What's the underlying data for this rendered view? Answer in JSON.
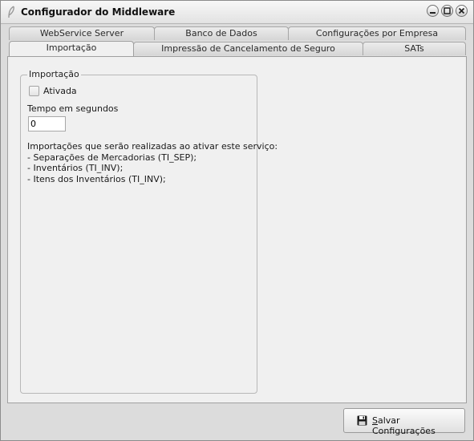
{
  "window": {
    "title": "Configurador do Middleware"
  },
  "tabs_row1": [
    {
      "label": "WebService Server"
    },
    {
      "label": "Banco de Dados"
    },
    {
      "label": "Configurações por Empresa"
    }
  ],
  "tabs_row2": [
    {
      "label": "Importação",
      "active": true
    },
    {
      "label": "Impressão de Cancelamento de Seguro"
    },
    {
      "label": "SATs"
    }
  ],
  "importacao": {
    "group_title": "Importação",
    "ativada_label": "Ativada",
    "ativada_checked": false,
    "tempo_label": "Tempo em segundos",
    "tempo_value": "0",
    "info_lines": [
      "Importações que serão realizadas ao ativar este serviço:",
      "- Separações de Mercadorias (TI_SEP);",
      "- Inventários (TI_INV);",
      "- Itens dos Inventários (TI_INV);"
    ]
  },
  "footer": {
    "save_label_first": "S",
    "save_label_rest": "alvar Configurações"
  },
  "icons": {
    "app": "feather-icon",
    "minimize": "minimize-icon",
    "maximize": "maximize-icon",
    "close": "close-icon",
    "save": "floppy-disk-icon"
  }
}
